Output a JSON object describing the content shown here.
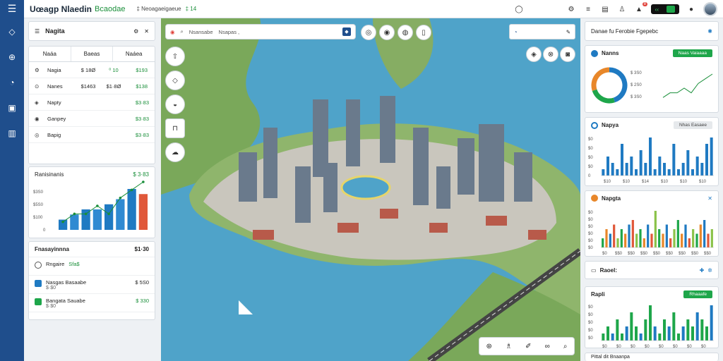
{
  "topbar": {
    "title": "Uœagp Nlaedin",
    "subtitle": "Bcaodae",
    "location": "‡ Neoagaeigaeue",
    "location_count": "‡ 14",
    "notif_count": "8",
    "toggle_label": "‹‹"
  },
  "left": {
    "head_title": "Nagita",
    "table_headers": [
      "Naáa",
      "Baeas",
      "Naáea"
    ],
    "rows": [
      {
        "name": "Nagia",
        "v1": "$ 18Ø",
        "v2": "⁰ 10",
        "v3": "$193"
      },
      {
        "name": "Nanes",
        "v1": "$1463",
        "v2": "$1·8Ø",
        "v3": "$138"
      },
      {
        "name": "Napty",
        "v1": "",
        "v2": "",
        "v3": "$3·83"
      },
      {
        "name": "Ganpey",
        "v1": "",
        "v2": "",
        "v3": "$3·83"
      },
      {
        "name": "Bapig",
        "v1": "",
        "v2": "",
        "v3": "$3·83"
      }
    ],
    "chart_title": "Ranisinanis",
    "chart_value": "$ 3·83",
    "chart_yticks": [
      "$3S0",
      "$5S0",
      "$100",
      "0"
    ],
    "list_title": "Fnasayinnna",
    "list_value": "$1·30",
    "list_items": [
      {
        "title": "Rngaire",
        "sub": "Sfa$",
        "right": ""
      },
      {
        "title": "Nasgas Basaabe",
        "sub": "$·$0",
        "right": "$ 5S0"
      },
      {
        "title": "Bangata Sauabe",
        "sub": "$·$0",
        "right": "$ 330"
      }
    ]
  },
  "map": {
    "search_text": "Nsansabe",
    "search_text2": "Nsapas ,"
  },
  "right": {
    "head_title": "Danae fu Ferobie Fgepebc",
    "card1_title": "Nanns",
    "card1_button": "Naas Vaiaaaa",
    "card1_legend": [
      "$ 3S0",
      "$ 2S0",
      "$ 3S0"
    ],
    "card2_title": "Napya",
    "card2_button": "Nhas Easaee",
    "card2_yticks": [
      "$0",
      "$0",
      "$0",
      "$0",
      "0"
    ],
    "card2_xticks": [
      "$10",
      "$10",
      "$14",
      "$10",
      "$10",
      "$10"
    ],
    "card3_title": "Napgta",
    "card3_yticks": [
      "$0",
      "$0",
      "$0",
      "$0",
      "$0",
      "$0"
    ],
    "card3_xticks": [
      "$0",
      "$$0",
      "$$0",
      "$$0",
      "$$0",
      "$$0",
      "$$0",
      "$$0",
      "$$0"
    ],
    "card4_title": "Raoel:",
    "card5_title": "Rapli",
    "card5_button": "Rhaaafe",
    "card5_yticks": [
      "$0",
      "$0",
      "$0",
      "$0",
      "$0"
    ],
    "card5_xticks": [
      "$0",
      "$0",
      "$0",
      "$0",
      "$0",
      "$0",
      "$0",
      "$0"
    ],
    "footer_text": "Pittal dit Bnaanpa"
  },
  "chart_data": [
    {
      "type": "bar",
      "categories": [
        "1",
        "2",
        "3",
        "4",
        "5",
        "6",
        "7",
        "8"
      ],
      "series": [
        {
          "values": [
            2,
            3,
            4,
            4,
            5,
            6,
            8,
            7
          ]
        }
      ]
    },
    {
      "type": "pie",
      "values": [
        45,
        25,
        30
      ]
    },
    {
      "type": "line",
      "values": [
        1,
        2,
        2,
        3,
        2,
        4,
        5,
        6
      ]
    },
    {
      "type": "bar",
      "categories": [
        "1",
        "2",
        "3",
        "4",
        "5",
        "6",
        "7",
        "8",
        "9",
        "10",
        "11",
        "12",
        "13",
        "14",
        "15",
        "16",
        "17",
        "18",
        "19",
        "20",
        "21",
        "22",
        "23",
        "24"
      ],
      "series": [
        {
          "values": [
            1,
            3,
            2,
            1,
            5,
            2,
            3,
            1,
            4,
            2,
            6,
            1,
            3,
            2,
            1,
            5,
            1,
            2,
            4,
            1,
            3,
            2,
            5,
            6
          ]
        }
      ]
    },
    {
      "type": "bar",
      "categories": [
        "1",
        "2",
        "3",
        "4",
        "5",
        "6",
        "7",
        "8",
        "9",
        "10",
        "11",
        "12",
        "13",
        "14",
        "15",
        "16",
        "17",
        "18",
        "19",
        "20",
        "21",
        "22",
        "23",
        "24",
        "25",
        "26",
        "27",
        "28",
        "29",
        "30"
      ],
      "series": [
        {
          "values": [
            2,
            4,
            3,
            5,
            2,
            4,
            3,
            5,
            6,
            3,
            4,
            2,
            5,
            3,
            8,
            4,
            3,
            5,
            2,
            4,
            6,
            3,
            5,
            2,
            4,
            3,
            5,
            6,
            3,
            4
          ]
        }
      ]
    },
    {
      "type": "bar",
      "categories": [
        "1",
        "2",
        "3",
        "4",
        "5",
        "6",
        "7",
        "8",
        "9",
        "10",
        "11",
        "12",
        "13",
        "14",
        "15",
        "16",
        "17",
        "18",
        "19",
        "20",
        "21",
        "22",
        "23",
        "24"
      ],
      "series": [
        {
          "values": [
            1,
            2,
            1,
            3,
            1,
            2,
            4,
            2,
            1,
            3,
            5,
            2,
            1,
            3,
            2,
            4,
            1,
            2,
            3,
            2,
            4,
            3,
            2,
            5
          ]
        }
      ]
    }
  ]
}
